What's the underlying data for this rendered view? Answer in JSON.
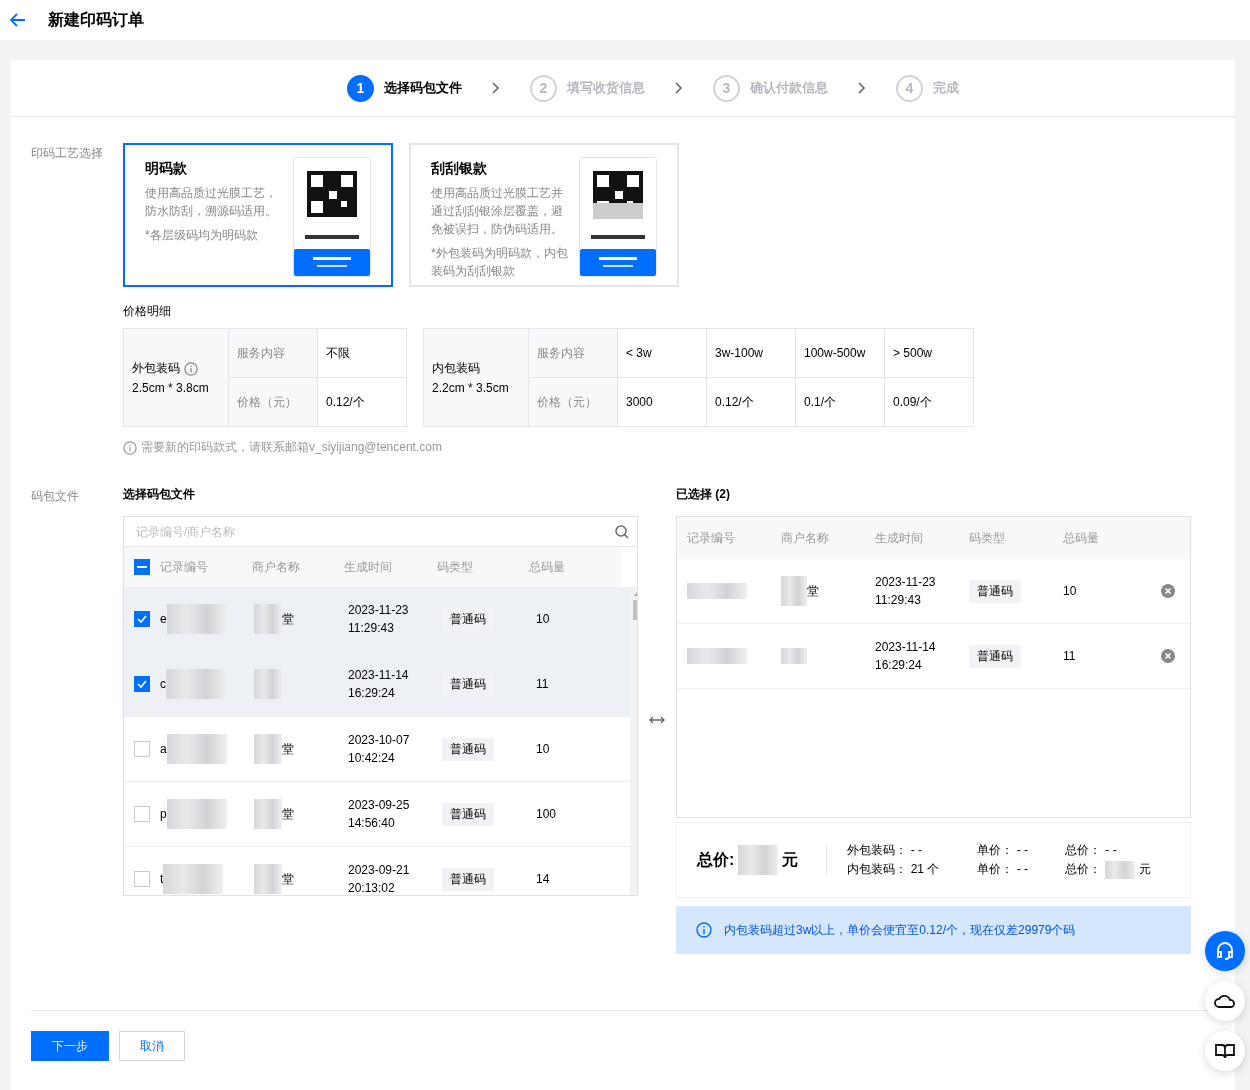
{
  "header": {
    "title": "新建印码订单"
  },
  "steps": [
    {
      "number": "1",
      "label": "选择码包文件",
      "selected": true
    },
    {
      "number": "2",
      "label": "填写收货信息",
      "selected": false
    },
    {
      "number": "3",
      "label": "确认付款信息",
      "selected": false
    },
    {
      "number": "4",
      "label": "完成",
      "selected": false
    }
  ],
  "process": {
    "label": "印码工艺选择",
    "options": [
      {
        "title": "明码款",
        "desc": "使用高品质过光膜工艺，防水防刮，溯源码适用。",
        "note": "*各层级码均为明码款",
        "selected": true,
        "kind": "plain"
      },
      {
        "title": "刮刮银款",
        "desc": "使用高品质过光膜工艺并通过刮刮银涂层覆盖，避免被误扫，防伪码适用。",
        "note": "*外包装码为明码款，内包装码为刮刮银款",
        "selected": false,
        "kind": "scratch"
      }
    ]
  },
  "price": {
    "title": "价格明细",
    "tables": [
      {
        "name": "外包装码",
        "size": "2.5cm * 3.8cm",
        "info": true,
        "row_labels": [
          "服务内容",
          "价格（元）"
        ],
        "tiers": [
          {
            "range": "不限",
            "price": "0.12/个"
          }
        ]
      },
      {
        "name": "内包装码",
        "size": "2.2cm * 3.5cm",
        "info": false,
        "row_labels": [
          "服务内容",
          "价格（元）"
        ],
        "tiers": [
          {
            "range": "< 3w",
            "price": "3000"
          },
          {
            "range": "3w-100w",
            "price": "0.12/个"
          },
          {
            "range": "100w-500w",
            "price": "0.1/个"
          },
          {
            "range": "> 500w",
            "price": "0.09/个"
          }
        ]
      }
    ],
    "hint": "需要新的印码款式，请联系邮箱v_siyijiang@tencent.com"
  },
  "files": {
    "label": "码包文件",
    "available": {
      "title": "选择码包文件",
      "search": {
        "placeholder": "记录编号/商户名称"
      },
      "columns": [
        "记录编号",
        "商户名称",
        "生成时间",
        "码类型",
        "总码量"
      ],
      "select_all": {
        "indeterminate": true
      },
      "rows": [
        {
          "record_id": "e",
          "merchant": "堂",
          "time": "2023-11-23 11:29:43",
          "type": "普通码",
          "count": "10",
          "selected": true
        },
        {
          "record_id": "c",
          "merchant": "",
          "time": "2023-11-14 16:29:24",
          "type": "普通码",
          "count": "11",
          "selected": true
        },
        {
          "record_id": "a",
          "merchant": "堂",
          "time": "2023-10-07 10:42:24",
          "type": "普通码",
          "count": "10",
          "selected": false
        },
        {
          "record_id": "p",
          "merchant": "堂",
          "time": "2023-09-25 14:56:40",
          "type": "普通码",
          "count": "100",
          "selected": false
        },
        {
          "record_id": "t",
          "merchant": "堂",
          "time": "2023-09-21 20:13:02",
          "type": "普通码",
          "count": "14",
          "selected": false
        }
      ]
    },
    "chosen": {
      "title": "已选择 (2)",
      "columns": [
        "记录编号",
        "商户名称",
        "生成时间",
        "码类型",
        "总码量"
      ],
      "rows": [
        {
          "merchant": "堂",
          "time": "2023-11-23 11:29:43",
          "type": "普通码",
          "count": "10"
        },
        {
          "merchant": "",
          "time": "2023-11-14 16:29:24",
          "type": "普通码",
          "count": "11"
        }
      ]
    },
    "summary": {
      "total_label": "总价:",
      "total_unit": "元",
      "lines": [
        {
          "label": "外包装码：",
          "count": "- -",
          "unit_label": "单价：",
          "unit_price": "- -",
          "total_label": "总价：",
          "total": "- -"
        },
        {
          "label": "内包装码：",
          "count": "21 个",
          "unit_label": "单价：",
          "unit_price": "- -",
          "total_label": "总价：",
          "total": "元"
        }
      ]
    },
    "notice": "内包装码超过3w以上，单价会便宜至0.12/个，现在仅差29979个码"
  },
  "footer": {
    "buttons": [
      {
        "label": "下一步",
        "kind": "primary"
      },
      {
        "label": "取消",
        "kind": "secondary"
      }
    ]
  }
}
